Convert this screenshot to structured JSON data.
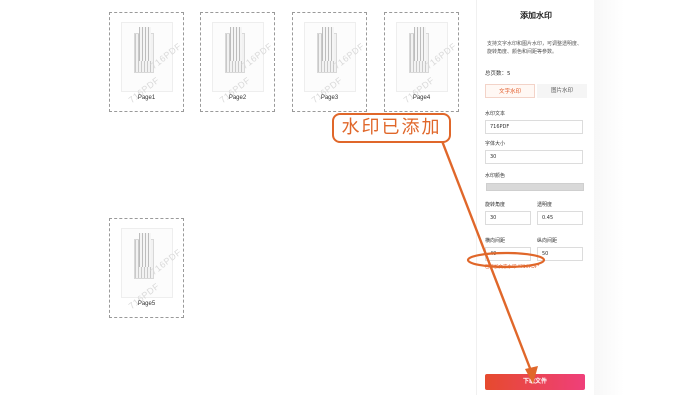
{
  "pages": [
    {
      "label": "Page1",
      "watermark": "716PDF"
    },
    {
      "label": "Page2",
      "watermark": "716PDF"
    },
    {
      "label": "Page3",
      "watermark": "716PDF"
    },
    {
      "label": "Page4",
      "watermark": "716PDF"
    },
    {
      "label": "Page5",
      "watermark": "716PDF"
    }
  ],
  "panel": {
    "title": "添加水印",
    "description": "支持文字水印和图片水印，可调整透明度、旋转角度、颜色和间距等参数。",
    "total_pages": "总页数：5",
    "tabs": [
      "文字水印",
      "图片水印"
    ],
    "watermark_text_label": "水印文本",
    "watermark_text_value": "716PDF",
    "font_size_label": "字体大小",
    "font_size_value": "30",
    "color_label": "水印颜色",
    "rotation_label": "旋转角度",
    "rotation_value": "30",
    "opacity_label": "透明度",
    "opacity_value": "0.45",
    "h_spacing_label": "横向间距",
    "h_spacing_value": "40",
    "v_spacing_label": "纵向间距",
    "v_spacing_value": "50",
    "hint": "已添加文字水印 \"716PDF\"",
    "download_label": "下载文件"
  },
  "annotation": {
    "callout_text": "水印已添加",
    "color": "#e0672a"
  }
}
